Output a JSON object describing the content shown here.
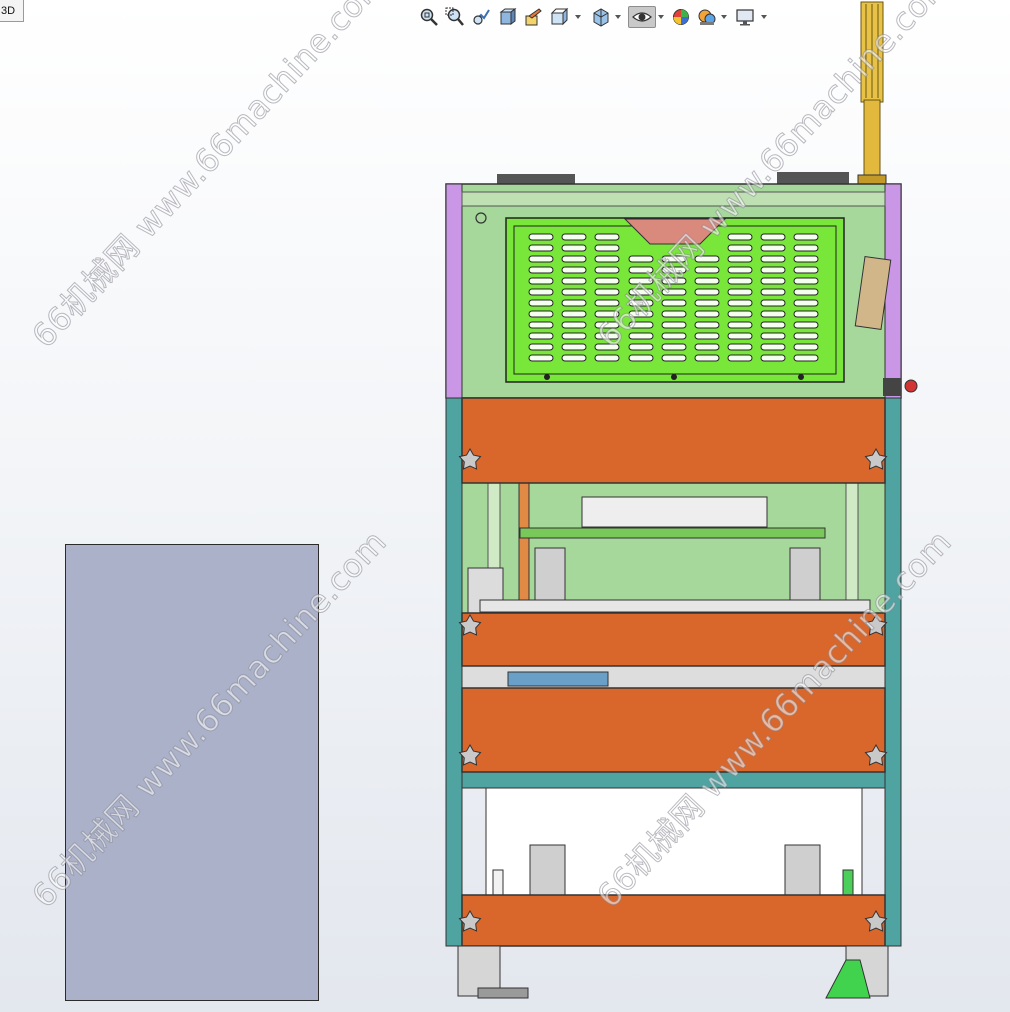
{
  "view_tab": {
    "label": "3D"
  },
  "toolbar": {
    "items": [
      {
        "name": "zoom-to-fit-icon"
      },
      {
        "name": "zoom-to-area-icon"
      },
      {
        "name": "previous-view-icon"
      },
      {
        "name": "section-view-icon"
      },
      {
        "name": "dynamic-annotation-icon"
      },
      {
        "name": "view-orientation-icon"
      },
      {
        "name": "display-style-icon"
      },
      {
        "name": "hide-show-items-icon"
      },
      {
        "name": "edit-appearance-icon"
      },
      {
        "name": "apply-scene-icon"
      },
      {
        "name": "view-settings-icon"
      }
    ]
  },
  "watermarks": [
    {
      "text": "66机械网 www.66machine.com"
    },
    {
      "text": "66机械网 www.66machine.com"
    },
    {
      "text": "66机械网 www.66machine.com"
    },
    {
      "text": "66机械网 www.66machine.com"
    }
  ],
  "colors": {
    "frame_teal": "#4fa3a0",
    "orange_panel": "#d9662b",
    "green_grille": "#79e63a",
    "light_green": "#a8dc8e",
    "purple_side": "#c997e6",
    "yellow_light": "#e2b93c",
    "side_panel": "#aab1c9"
  }
}
